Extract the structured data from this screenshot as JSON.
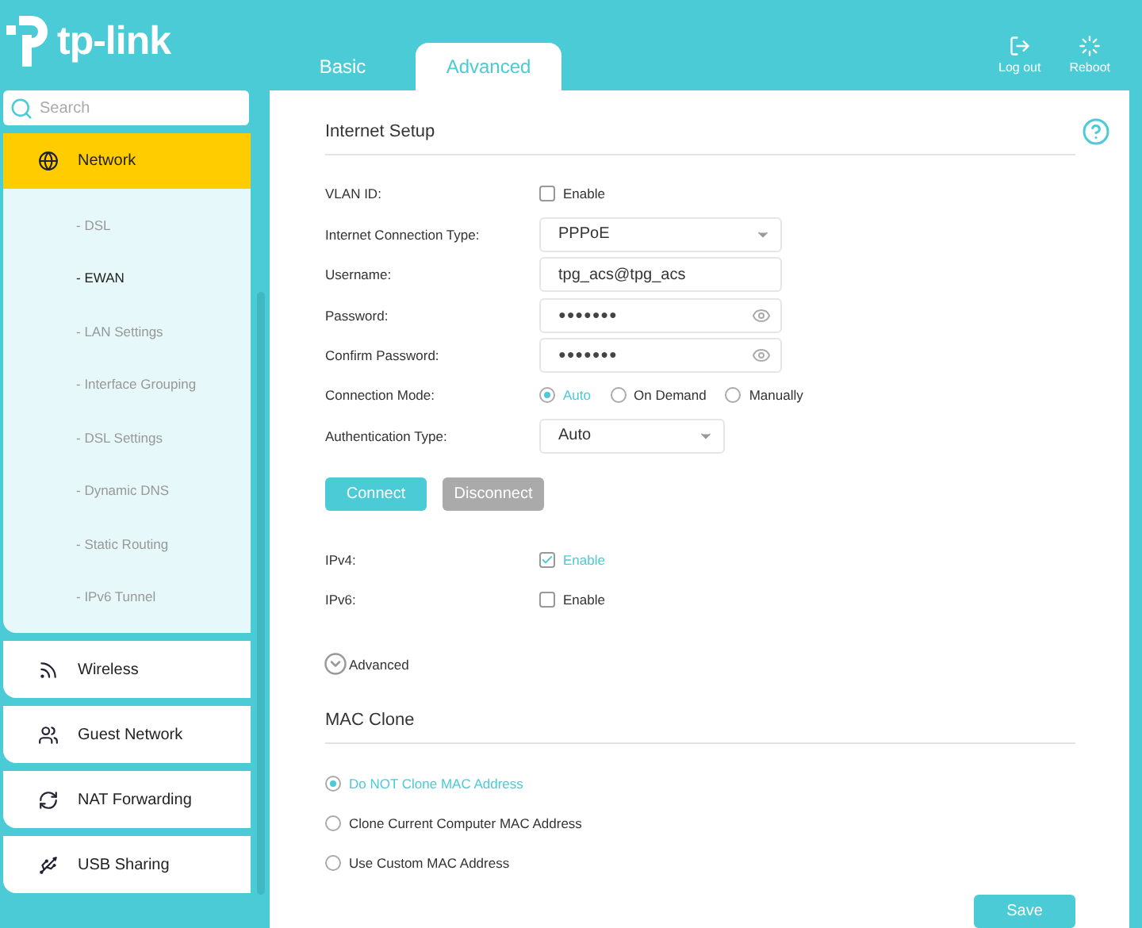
{
  "header": {
    "logo": "tp-link",
    "tabs": [
      {
        "label": "Basic",
        "selected": false
      },
      {
        "label": "Advanced",
        "selected": true
      }
    ],
    "actions": [
      {
        "kind": "logout",
        "label": "Log out"
      },
      {
        "kind": "reboot",
        "label": "Reboot"
      }
    ]
  },
  "sidebar": {
    "search": {
      "placeholder": "Search"
    },
    "items": [
      {
        "kind": "network",
        "label": "Network",
        "selected": true,
        "expanded": true,
        "children": [
          {
            "label": "- DSL",
            "selected": false
          },
          {
            "label": "- EWAN",
            "selected": true
          },
          {
            "label": "- LAN Settings",
            "selected": false
          },
          {
            "label": "- Interface Grouping",
            "selected": false
          },
          {
            "label": "- DSL Settings",
            "selected": false
          },
          {
            "label": "- Dynamic DNS",
            "selected": false
          },
          {
            "label": "- Static Routing",
            "selected": false
          },
          {
            "label": "- IPv6 Tunnel",
            "selected": false
          }
        ]
      },
      {
        "kind": "wireless",
        "label": "Wireless",
        "selected": false,
        "expanded": false
      },
      {
        "kind": "guest",
        "label": "Guest Network",
        "selected": false,
        "expanded": false
      },
      {
        "kind": "nat",
        "label": "NAT Forwarding",
        "selected": false,
        "expanded": false
      },
      {
        "kind": "usb",
        "label": "USB Sharing",
        "selected": false,
        "expanded": false
      }
    ]
  },
  "internet_setup": {
    "title": "Internet Setup",
    "fields": [
      {
        "kind": "checkbox",
        "label": "VLAN ID:",
        "option": "Enable",
        "checked": false
      },
      {
        "kind": "select",
        "label": "Internet Connection Type:",
        "value": "PPPoE"
      },
      {
        "kind": "text",
        "label": "Username:",
        "value": "tpg_acs@tpg_acs"
      },
      {
        "kind": "password",
        "label": "Password:",
        "value": "●●●●●●●"
      },
      {
        "kind": "password",
        "label": "Confirm Password:",
        "value": "●●●●●●●"
      },
      {
        "kind": "radio",
        "label": "Connection Mode:",
        "options": [
          {
            "label": "Auto",
            "selected": true
          },
          {
            "label": "On Demand",
            "selected": false
          },
          {
            "label": "Manually",
            "selected": false
          }
        ]
      },
      {
        "kind": "short-select",
        "label": "Authentication Type:",
        "value": "Auto"
      }
    ],
    "buttons": [
      {
        "label": "Connect",
        "disabled": false
      },
      {
        "label": "Disconnect",
        "disabled": true
      }
    ],
    "protocols": [
      {
        "label": "IPv4:",
        "option": "Enable",
        "checked": true
      },
      {
        "label": "IPv6:",
        "option": "Enable",
        "checked": false
      }
    ],
    "advanced_toggle": {
      "label": "Advanced",
      "expanded": false
    }
  },
  "mac_clone": {
    "title": "MAC Clone",
    "options": [
      {
        "label": "Do NOT Clone MAC Address",
        "selected": true
      },
      {
        "label": "Clone Current Computer MAC Address",
        "selected": false
      },
      {
        "label": "Use Custom MAC Address",
        "selected": false
      }
    ]
  },
  "save_button": {
    "label": "Save"
  }
}
